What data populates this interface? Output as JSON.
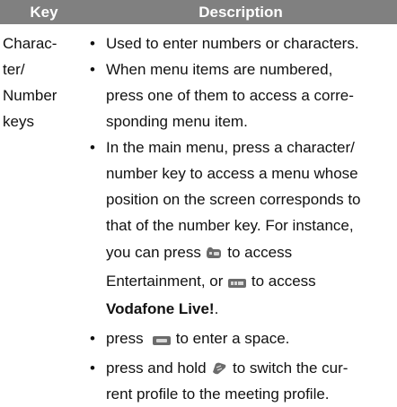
{
  "header": {
    "key": "Key",
    "description": "Description"
  },
  "row": {
    "key_lines": [
      "Charac-",
      "ter/",
      "Number",
      "keys"
    ],
    "bullet_glyph": "•",
    "bullets": [
      {
        "lines": [
          "Used to enter numbers or characters."
        ]
      },
      {
        "lines": [
          "When menu items are numbered,",
          "press one of them to access a corre-",
          "sponding menu item."
        ]
      },
      {
        "lines": [
          "In the main menu, press a character/",
          "number key to access a menu whose",
          "position on the screen corresponds to",
          "that of the number key. For instance,"
        ],
        "line5_before": "you can press ",
        "line5_icon": "key-3-icon",
        "line5_after": " to access",
        "line6_before": "Entertainment, or ",
        "line6_icon": "key-6-icon",
        "line6_after": " to access",
        "line7_bold": "Vodafone Live!",
        "line7_after": "."
      },
      {
        "before": "press ",
        "icon": "key-0-icon",
        "after": " to enter a space."
      },
      {
        "before": "press and hold ",
        "icon": "key-hash-icon",
        "after": " to switch the cur-",
        "line2": "rent profile to the meeting profile."
      }
    ]
  },
  "colors": {
    "header_bg": "#808080",
    "header_text": "#ffffff",
    "text": "#111111",
    "key_icon": "#6b6b6b"
  }
}
